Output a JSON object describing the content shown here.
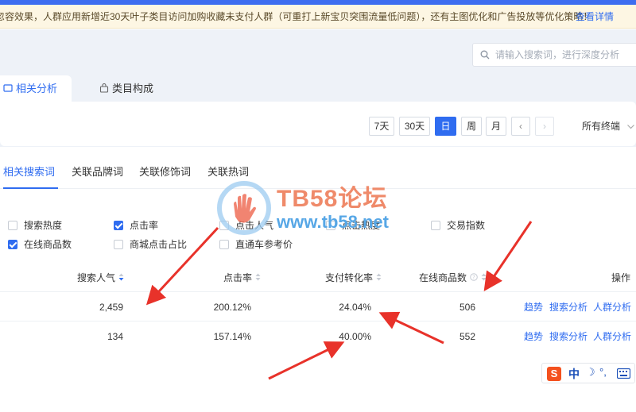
{
  "notice": {
    "text": "忽容效果，人群应用新增近30天叶子类目访问加购收藏未支付人群（可重打上新宝贝突围流量低问题），还有主图优化和广告投放等优化策略！",
    "link": "查看详情"
  },
  "search": {
    "placeholder": "请输入搜索词，进行深度分析"
  },
  "main_tabs": [
    {
      "label": "相关分析"
    },
    {
      "label": "类目构成"
    }
  ],
  "time_ranges": [
    {
      "label": "7天"
    },
    {
      "label": "30天"
    },
    {
      "label": "日"
    },
    {
      "label": "周"
    },
    {
      "label": "月"
    }
  ],
  "time_prev": "‹",
  "time_next": "›",
  "device": {
    "label": "所有终端"
  },
  "sub_tabs": [
    {
      "label": "相关搜索词"
    },
    {
      "label": "关联品牌词"
    },
    {
      "label": "关联修饰词"
    },
    {
      "label": "关联热词"
    }
  ],
  "metrics": [
    {
      "label": "搜索热度",
      "checked": false
    },
    {
      "label": "点击率",
      "checked": true
    },
    {
      "label": "点击人气",
      "checked": false
    },
    {
      "label": "点击热度",
      "checked": false
    },
    {
      "label": "交易指数",
      "checked": false
    },
    {
      "label": "在线商品数",
      "checked": true
    },
    {
      "label": "商城点击占比",
      "checked": false
    },
    {
      "label": "直通车参考价",
      "checked": false
    }
  ],
  "table": {
    "headers": {
      "search_popularity": "搜索人气",
      "ctr": "点击率",
      "conversion": "支付转化率",
      "online_items": "在线商品数",
      "actions": "操作"
    },
    "rows": [
      {
        "search_popularity": "2,459",
        "ctr": "200.12%",
        "conversion": "24.04%",
        "online_items": "506"
      },
      {
        "search_popularity": "134",
        "ctr": "157.14%",
        "conversion": "40.00%",
        "online_items": "552"
      }
    ],
    "row_actions": [
      "趋势",
      "搜索分析",
      "人群分析"
    ]
  },
  "watermark": {
    "title": "TB58论坛",
    "url": "www.tb58.net"
  },
  "ime": {
    "logo": "S",
    "mode": "中",
    "glyph_a": "☽",
    "glyph_b": "°,"
  },
  "colors": {
    "accent": "#2f6cf0",
    "arrow": "#e8322a",
    "notice_bg": "#fdf6e3"
  }
}
